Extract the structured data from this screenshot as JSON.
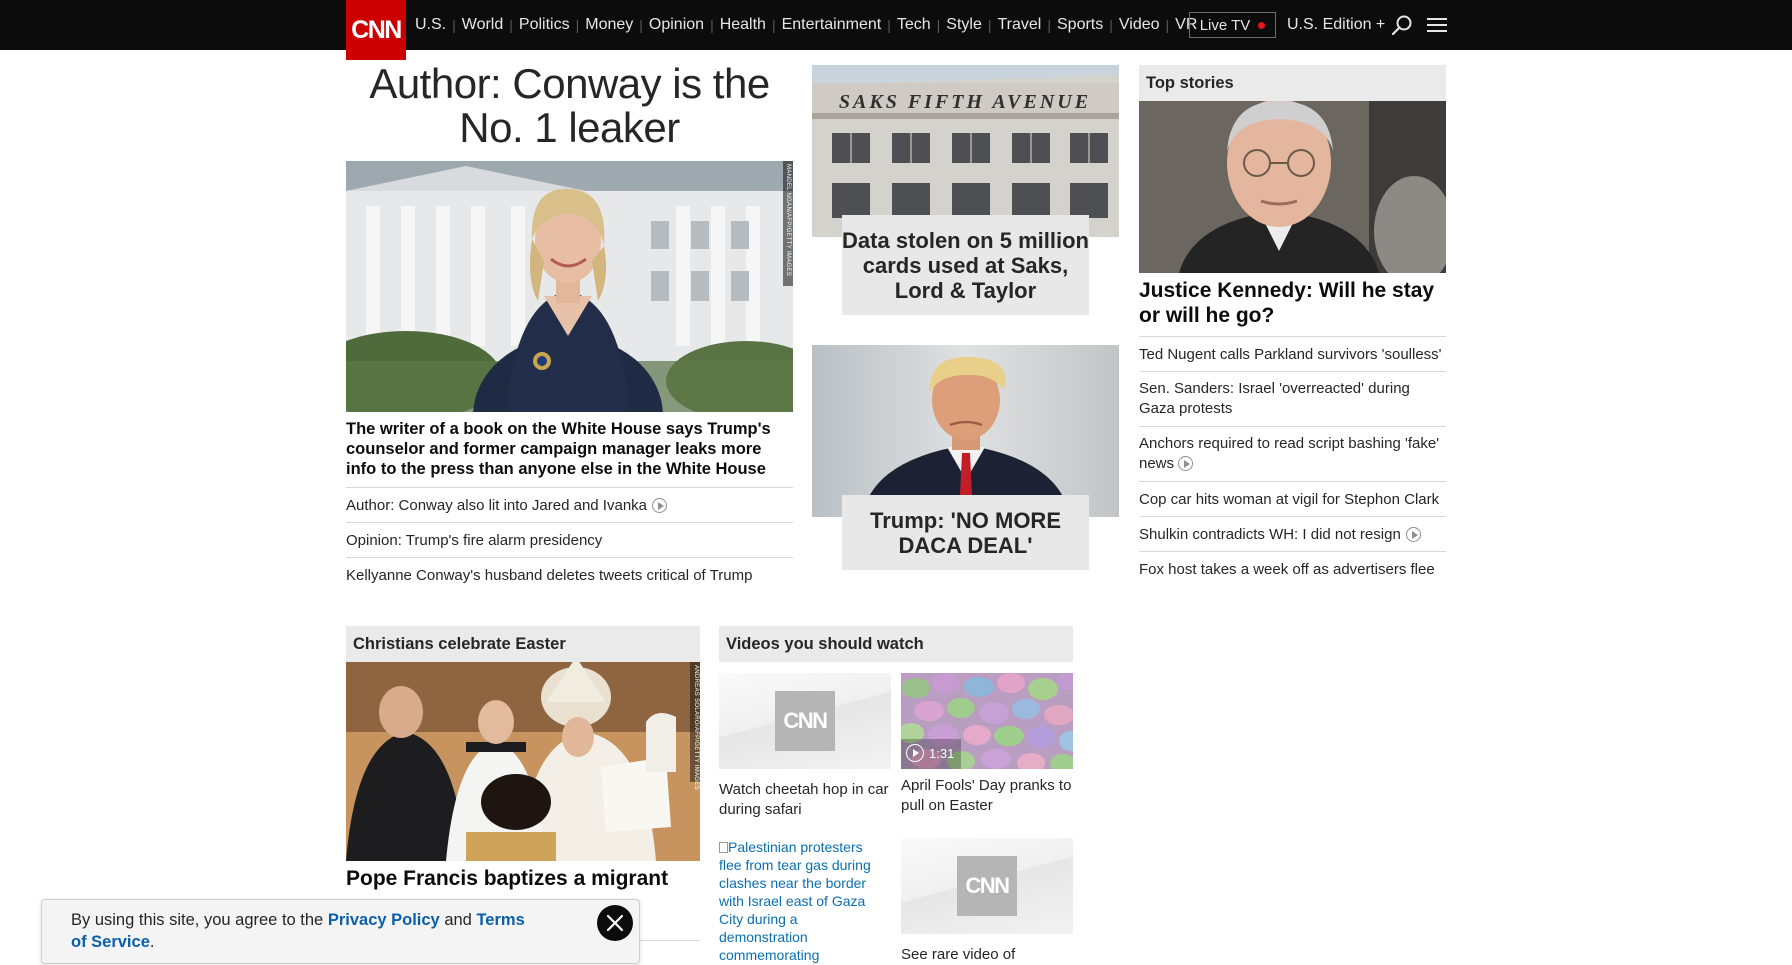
{
  "nav": {
    "logo": "CNN",
    "links": [
      "U.S.",
      "World",
      "Politics",
      "Money",
      "Opinion",
      "Health",
      "Entertainment",
      "Tech",
      "Style",
      "Travel",
      "Sports",
      "Video",
      "VR"
    ],
    "live_tv": "Live TV",
    "edition": "U.S. Edition +",
    "icons": [
      "search-icon",
      "menu-icon"
    ]
  },
  "hero": {
    "headline_line1": "Author: Conway is the",
    "headline_line2": "No. 1 leaker",
    "photo_credit": "MANDEL NGAN/AFP/GETTY IMAGES",
    "description": "The writer of a book on the White House says Trump's counselor and former campaign manager leaks more info to the press than anyone else in the White House",
    "related": [
      {
        "text": "Author: Conway also lit into Jared and Ivanka",
        "video": true
      },
      {
        "text": "Opinion: Trump's fire alarm presidency",
        "video": false
      },
      {
        "text": "Kellyanne Conway's husband deletes tweets critical of Trump",
        "video": false
      }
    ]
  },
  "cards": {
    "saks": {
      "sign": "SAKS FIFTH AVENUE",
      "caption": "Data stolen on 5 million cards used at Saks, Lord & Taylor"
    },
    "trump": {
      "caption": "Trump: 'NO MORE DACA DEAL'"
    }
  },
  "top_stories": {
    "header": "Top stories",
    "headline": "Justice Kennedy: Will he stay or will he go?",
    "items": [
      {
        "text": "Ted Nugent calls Parkland survivors 'soulless'",
        "video": false
      },
      {
        "text": "Sen. Sanders: Israel 'overreacted' during Gaza protests",
        "video": false
      },
      {
        "text": "Anchors required to read script bashing 'fake' news",
        "video": true
      },
      {
        "text": "Cop car hits woman at vigil for Stephon Clark",
        "video": false
      },
      {
        "text": "Shulkin contradicts WH: I did not resign",
        "video": true
      },
      {
        "text": "Fox host takes a week off as advertisers flee",
        "video": false
      }
    ]
  },
  "easter": {
    "header": "Christians celebrate Easter",
    "photo_credit": "ANDREAS SOLARO/AFP/GETTY IMAGES",
    "headline": "Pope Francis baptizes a migrant"
  },
  "videos": {
    "header": "Videos you should watch",
    "items": [
      {
        "caption": "Watch cheetah hop in car during safari",
        "logo": "CNN"
      },
      {
        "caption": "April Fools' Day pranks to pull on Easter",
        "duration": "1:31"
      },
      {
        "caption": "Palestinian protesters flee from tear gas during clashes near the border with Israel east of Gaza City during a demonstration commemorating"
      },
      {
        "caption": "See rare video of",
        "logo": "CNN"
      }
    ]
  },
  "cookie_bar": {
    "prefix": "By using this site, you agree to the ",
    "privacy": "Privacy Policy",
    "and": " and ",
    "terms": "Terms of Service",
    "suffix": "."
  }
}
